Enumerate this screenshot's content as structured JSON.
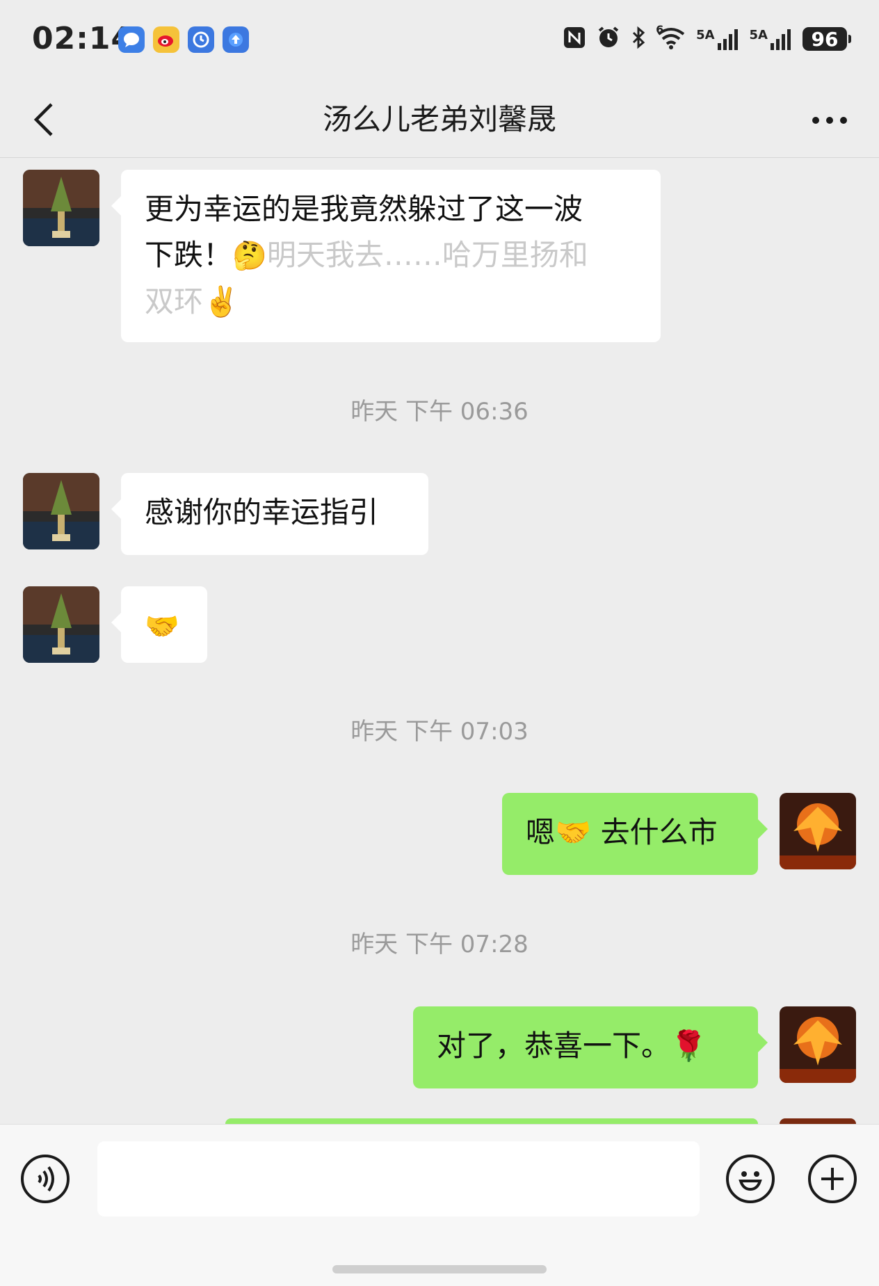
{
  "status_bar": {
    "time": "02:14",
    "battery": "96",
    "signal_1": "5A",
    "signal_2": "5A",
    "wifi_label": "6",
    "icons": [
      "message-app-icon",
      "weibo-icon",
      "clock-app-icon",
      "upload-app-icon",
      "nfc-icon",
      "alarm-icon",
      "bluetooth-icon",
      "wifi-icon",
      "signal-icon",
      "signal-icon",
      "battery-icon"
    ]
  },
  "header": {
    "title": "汤么儿老弟刘馨晟"
  },
  "messages": [
    {
      "side": "left",
      "line1": "更为幸运的是我竟然躲过了这一波",
      "line2_prefix": "下跌！",
      "line2_emoji": "🤔",
      "line2_faded": "明天我去……哈万里扬和",
      "line3_faded": "双环✌️"
    },
    {
      "side": "time",
      "text": "昨天 下午 06:36"
    },
    {
      "side": "left",
      "text": "感谢你的幸运指引"
    },
    {
      "side": "left",
      "text": "🤝"
    },
    {
      "side": "time",
      "text": "昨天 下午 07:03"
    },
    {
      "side": "right",
      "text": "嗯🤝 去什么市"
    },
    {
      "side": "time",
      "text": "昨天 下午 07:28"
    },
    {
      "side": "right",
      "text": "对了，恭喜一下。🌹"
    }
  ],
  "input": {
    "placeholder": ""
  },
  "colors": {
    "background": "#ededed",
    "bubble_in": "#ffffff",
    "bubble_out": "#95ec69",
    "timestamp": "#9a9a9a"
  }
}
